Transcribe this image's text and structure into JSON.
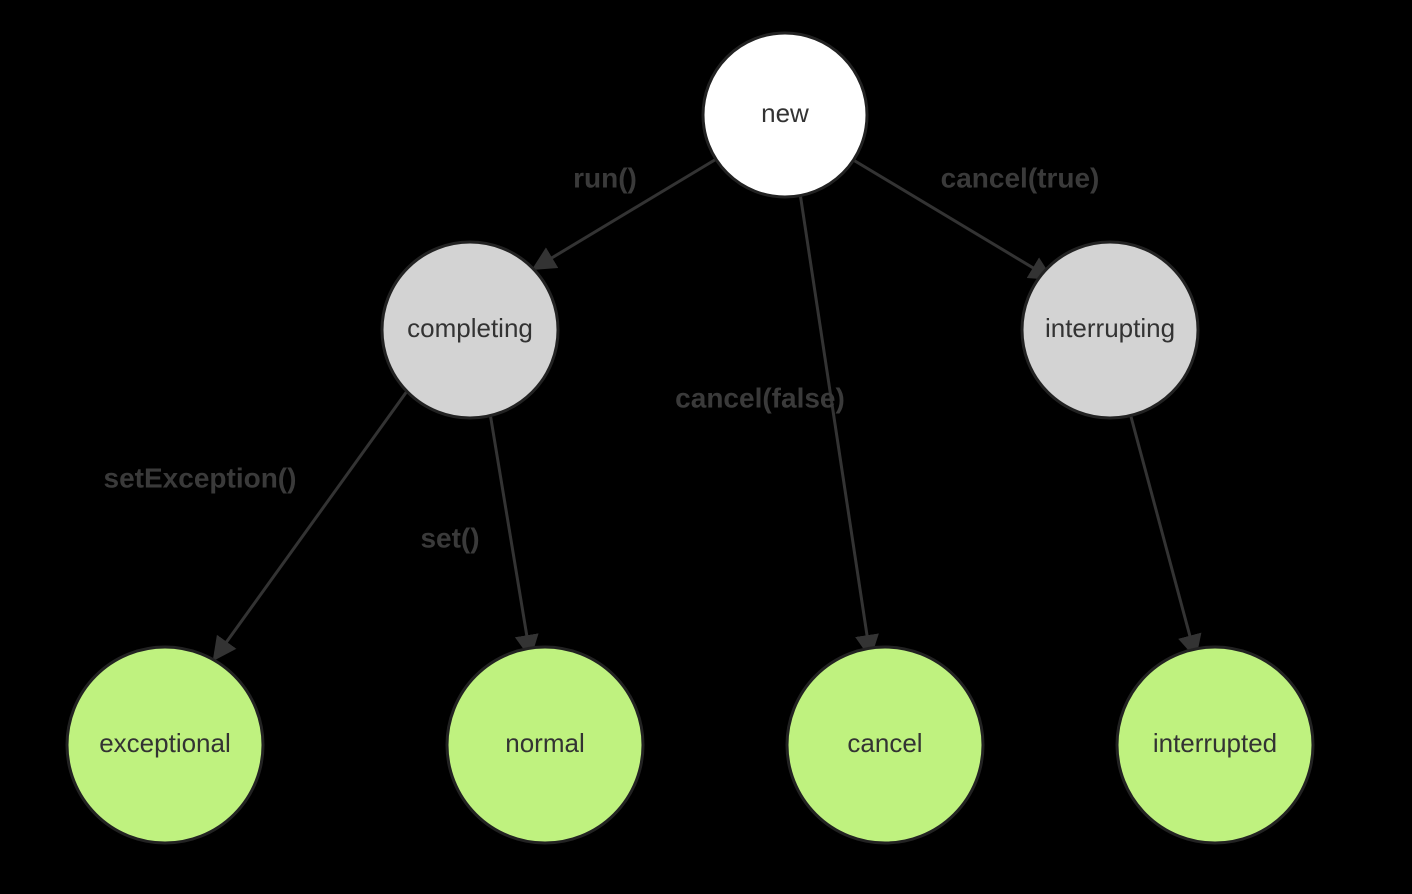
{
  "nodes": {
    "new": {
      "label": "new",
      "fill": "white"
    },
    "completing": {
      "label": "completing",
      "fill": "gray"
    },
    "interrupting": {
      "label": "interrupting",
      "fill": "gray"
    },
    "exceptional": {
      "label": "exceptional",
      "fill": "green"
    },
    "normal": {
      "label": "normal",
      "fill": "green"
    },
    "cancel": {
      "label": "cancel",
      "fill": "green"
    },
    "interrupted": {
      "label": "interrupted",
      "fill": "green"
    }
  },
  "edges": {
    "run": {
      "label": "run()",
      "from": "new",
      "to": "completing"
    },
    "cancelTrue": {
      "label": "cancel(true)",
      "from": "new",
      "to": "interrupting"
    },
    "cancelFalse": {
      "label": "cancel(false)",
      "from": "new",
      "to": "cancel"
    },
    "setException": {
      "label": "setException()",
      "from": "completing",
      "to": "exceptional"
    },
    "set": {
      "label": "set()",
      "from": "completing",
      "to": "normal"
    },
    "interrupt": {
      "label": "",
      "from": "interrupting",
      "to": "interrupted"
    }
  },
  "colors": {
    "background": "#000000",
    "nodeStroke": "#222222",
    "white": "#ffffff",
    "gray": "#d3d3d3",
    "green": "#bff27f",
    "edge": "#333333",
    "text": "#333333"
  }
}
